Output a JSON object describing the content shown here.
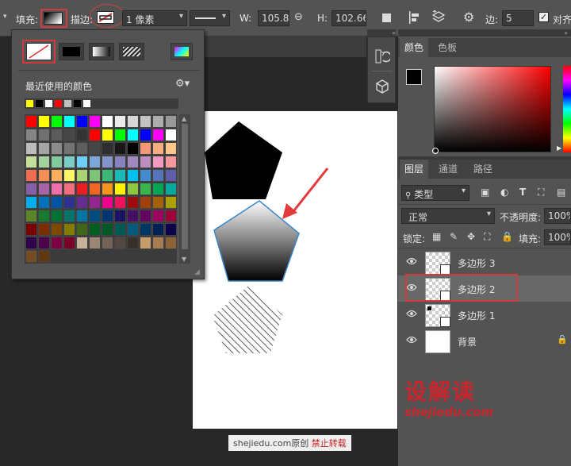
{
  "optionsbar": {
    "fill_label": "填充:",
    "stroke_label": "描边:",
    "stroke_width": "1 像素",
    "w_label": "W:",
    "w_value": "105.88 |",
    "h_label": "H:",
    "h_value": "102.66 |",
    "sides_label": "边:",
    "sides_value": "5",
    "align_label": "对齐"
  },
  "popup": {
    "recent_title": "最近使用的颜色",
    "recent_colors": [
      "#ffff00",
      "#000000",
      "#ffffff",
      "#ff0000",
      "#bfbfbf",
      "#000000",
      "#ffffff"
    ],
    "swatches": [
      [
        "#ff0000",
        "#ffff00",
        "#00ff00",
        "#00ffff",
        "#0000ff",
        "#ff00ff",
        "#ffffff",
        "#ebebeb",
        "#d6d6d6",
        "#c2c2c2",
        "#adadad",
        "#999999"
      ],
      [
        "#858585",
        "#707070",
        "#5c5c5c",
        "#474747",
        "#333333",
        "#ff0000",
        "#ffff00",
        "#00ff00",
        "#00ffff",
        "#0000ff",
        "#ff00ff",
        "#ffffff"
      ],
      [
        "#bdbdbd",
        "#a5a5a5",
        "#8c8c8c",
        "#737373",
        "#5e5e5e",
        "#464646",
        "#2e2e2e",
        "#171717",
        "#000000",
        "#f7977a",
        "#f9ad81",
        "#fdc68a"
      ],
      [
        "#c4df9b",
        "#a3d39c",
        "#82ca9d",
        "#7bcdc8",
        "#6ecff6",
        "#7ea7d8",
        "#8493ca",
        "#8882be",
        "#a187be",
        "#bc8dbf",
        "#f49ac2",
        "#f6989d"
      ],
      [
        "#f26c4f",
        "#f68e55",
        "#fbaf5c",
        "#fff467",
        "#acd372",
        "#7cc576",
        "#3bb878",
        "#1abbb4",
        "#00bff3",
        "#438ccb",
        "#5574b9",
        "#605ca8"
      ],
      [
        "#855fa8",
        "#a763a8",
        "#f06ea9",
        "#f26d7d",
        "#ed1c24",
        "#f26522",
        "#f7941d",
        "#fff200",
        "#8dc73f",
        "#39b54a",
        "#00a651",
        "#00a99d"
      ],
      [
        "#00aeef",
        "#0072bc",
        "#0054a6",
        "#2e3192",
        "#662d91",
        "#92278f",
        "#ec008c",
        "#ed145b",
        "#9e0b0f",
        "#a0410d",
        "#a36209",
        "#aba000"
      ],
      [
        "#598527",
        "#1a7b30",
        "#007236",
        "#00746b",
        "#0076a3",
        "#004b80",
        "#003471",
        "#1b1464",
        "#440e62",
        "#630460",
        "#9e005d",
        "#9e0039"
      ],
      [
        "#790000",
        "#7b2e00",
        "#7d4900",
        "#827b00",
        "#406618",
        "#005e20",
        "#005826",
        "#005952",
        "#005b7f",
        "#003663",
        "#002157",
        "#0d004c"
      ],
      [
        "#32004b",
        "#4b0049",
        "#7b0046",
        "#7a0026",
        "#c7b299",
        "#998675",
        "#736357",
        "#534741",
        "#37302a",
        "#c69c6d",
        "#a67c52",
        "#8c6239"
      ],
      [
        "#754c24",
        "#603913"
      ]
    ]
  },
  "tabs": {
    "color": "颜色",
    "swatches": "色板",
    "layers": "图层",
    "channels": "通道",
    "paths": "路径"
  },
  "layers": {
    "filter_kind": "类型",
    "blend_mode": "正常",
    "opacity_label": "不透明度:",
    "opacity_value": "100%",
    "lock_label": "锁定:",
    "fill_label": "填充:",
    "fill_value": "100%",
    "items": [
      {
        "name": "多边形 3"
      },
      {
        "name": "多边形 2"
      },
      {
        "name": "多边形 1"
      },
      {
        "name": "背景"
      }
    ]
  },
  "logo": {
    "cn": "设解读",
    "url": "shejiedu.com"
  },
  "watermark": {
    "site": "shejiedu.com原创",
    "notice": "禁止转载"
  },
  "colors": {
    "accent_red": "#d23b3b",
    "canvas_bg": "#ffffff",
    "shape_stroke": "#3a86c8"
  }
}
